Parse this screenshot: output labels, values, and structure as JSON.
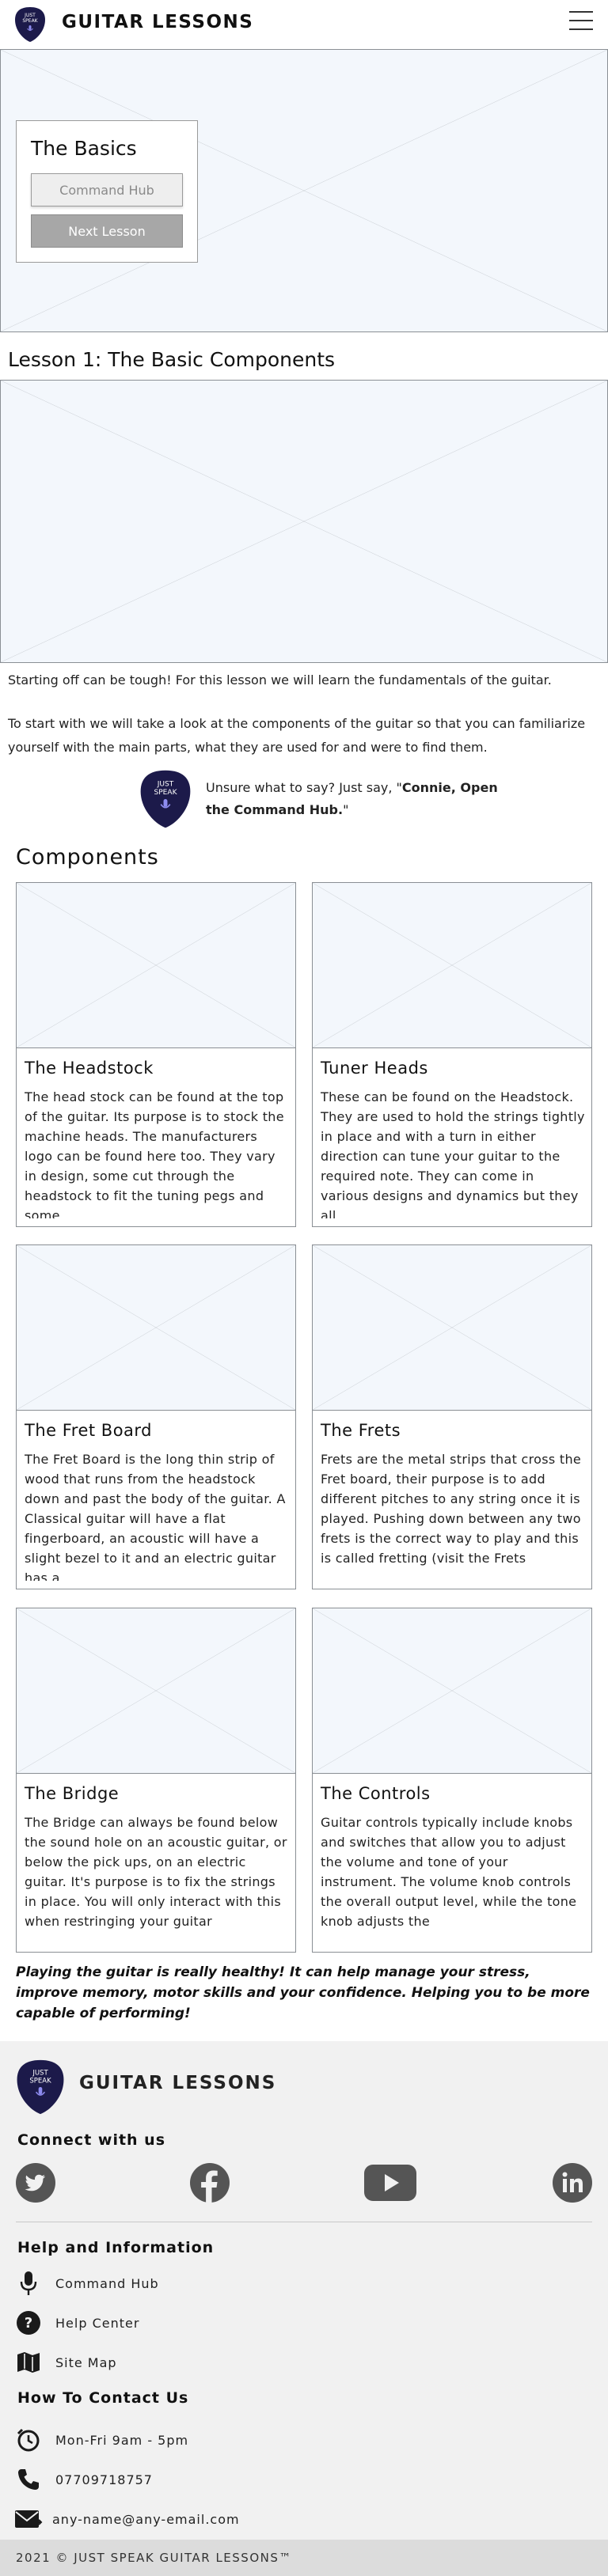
{
  "header": {
    "logo_text_line1": "JUST",
    "logo_text_line2": "SPEAK",
    "title": "GUITAR LESSONS",
    "menu_icon": "hamburger-menu-icon"
  },
  "hero": {
    "card_title": "The Basics",
    "command_hub_button": "Command Hub",
    "next_lesson_button": "Next Lesson"
  },
  "lesson": {
    "title": "Lesson 1: The Basic Components",
    "intro": "Starting off can be tough! For this lesson we will learn the fundamentals of the guitar.",
    "detail": "To start with we will take a look at the components of the guitar so that you can familiarize yourself with the main parts, what they are used for and were to find them.",
    "tip_prefix": "Unsure what to say? Just say, \"",
    "tip_command": "Connie, Open the Command Hub.",
    "tip_suffix": "\""
  },
  "components": {
    "title": "Components",
    "cards": [
      {
        "title": "The Headstock",
        "body": "The head stock can be found at the top of the guitar. Its purpose is to stock the machine heads. The manufacturers logo can be found here too. They vary in design, some cut through the headstock to fit the tuning pegs and some"
      },
      {
        "title": "Tuner Heads",
        "body": "These can be found on the Headstock. They are used to hold the strings tightly in place and with a turn in either direction can tune your guitar to the required note. They can come in various designs and dynamics but they all"
      },
      {
        "title": "The Fret Board",
        "body": "The Fret Board is the long thin strip of wood that runs from the headstock down and past the body of the guitar. A Classical guitar will have a flat fingerboard, an acoustic will have a slight bezel to it and an electric guitar has a"
      },
      {
        "title": "The Frets",
        "body": "Frets are the metal strips that cross the Fret board, their purpose is to add different pitches to any string once it is played. Pushing down between any two frets is the correct way to play and this is called fretting (visit the Frets"
      },
      {
        "title": "The Bridge",
        "body": "The Bridge can always be found below the sound hole on an acoustic guitar, or below the pick ups, on an electric guitar. It's purpose is to fix the strings in place. You will only interact with this when restringing your guitar"
      },
      {
        "title": "The Controls",
        "body": "Guitar controls typically include knobs and switches that allow you to adjust the volume and tone of your instrument. The volume knob controls the overall output level, while the tone knob adjusts the"
      }
    ]
  },
  "health_note": "Playing the guitar is really healthy! It can help manage your stress, improve memory, motor skills and your confidence. Helping you to be more capable of performing!",
  "footer": {
    "brand": "GUITAR LESSONS",
    "connect_heading": "Connect with us",
    "social_icons": [
      "twitter-icon",
      "facebook-icon",
      "youtube-icon",
      "linkedin-icon"
    ],
    "help_heading": "Help and Information",
    "help_links": [
      "Command Hub",
      "Help Center",
      "Site Map"
    ],
    "contact_heading": "How To Contact Us",
    "hours": "Mon-Fri 9am - 5pm",
    "phone": "07709718757",
    "email": "any-name@any-email.com"
  },
  "copyright": "2021 © JUST SPEAK GUITAR LESSONS™",
  "colors": {
    "brand_navy": "#1c1a4a",
    "placeholder_fill": "#f3f7fc",
    "footer_bg": "#f1f1f1"
  }
}
